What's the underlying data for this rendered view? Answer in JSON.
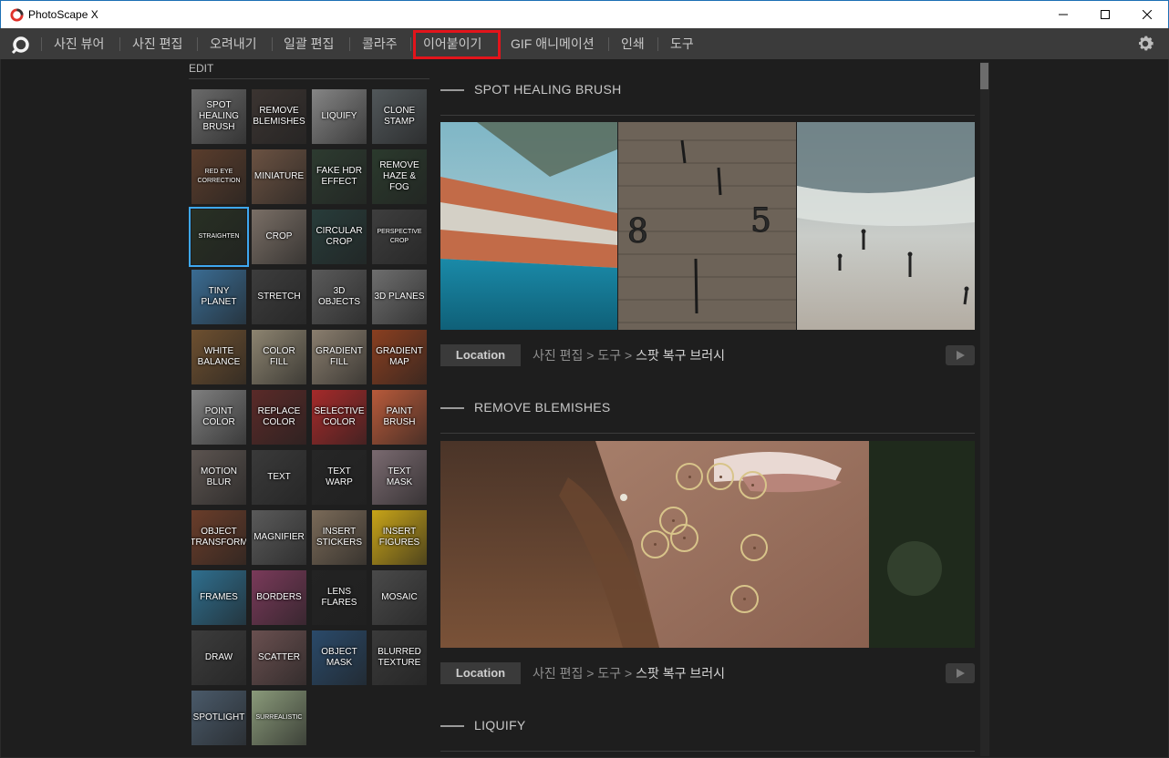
{
  "window": {
    "title": "PhotoScape X"
  },
  "menu": {
    "items": [
      "사진 뷰어",
      "사진 편집",
      "오려내기",
      "일괄 편집",
      "콜라주",
      "이어붙이기",
      "GIF 애니메이션",
      "인쇄",
      "도구"
    ],
    "highlighted": "이어붙이기"
  },
  "sidebar": {
    "label": "EDIT",
    "selected": "STRAIGHTEN",
    "tiles": [
      {
        "label": "SPOT HEALING BRUSH",
        "bg": "#6a6a6a"
      },
      {
        "label": "REMOVE BLEMISHES",
        "bg": "#3b3431"
      },
      {
        "label": "LIQUIFY",
        "bg": "#858585"
      },
      {
        "label": "CLONE STAMP",
        "bg": "#51575a"
      },
      {
        "label": "RED EYE CORRECTION",
        "bg": "#5a3d2c"
      },
      {
        "label": "MINIATURE",
        "bg": "#6b5242"
      },
      {
        "label": "FAKE HDR EFFECT",
        "bg": "#2d3b30"
      },
      {
        "label": "REMOVE HAZE & FOG",
        "bg": "#2b3a2d"
      },
      {
        "label": "STRAIGHTEN",
        "bg": "#283024"
      },
      {
        "label": "CROP",
        "bg": "#7a6f66"
      },
      {
        "label": "CIRCULAR CROP",
        "bg": "#283c3a"
      },
      {
        "label": "PERSPECTIVE CROP",
        "bg": "#3e3e3e"
      },
      {
        "label": "TINY PLANET",
        "bg": "#3a6c93"
      },
      {
        "label": "STRETCH",
        "bg": "#3d3d3d"
      },
      {
        "label": "3D OBJECTS",
        "bg": "#5a5a5a"
      },
      {
        "label": "3D PLANES",
        "bg": "#6e6e6e"
      },
      {
        "label": "WHITE BALANCE",
        "bg": "#6e5030"
      },
      {
        "label": "COLOR FILL",
        "bg": "#8d8470"
      },
      {
        "label": "GRADIENT FILL",
        "bg": "#8a7e6e"
      },
      {
        "label": "GRADIENT MAP",
        "bg": "#8a3f20"
      },
      {
        "label": "POINT COLOR",
        "bg": "#7f7f7f"
      },
      {
        "label": "REPLACE COLOR",
        "bg": "#5a2a28"
      },
      {
        "label": "SELECTIVE COLOR",
        "bg": "#a52a2a"
      },
      {
        "label": "PAINT BRUSH",
        "bg": "#b85a3a"
      },
      {
        "label": "MOTION BLUR",
        "bg": "#5c5450"
      },
      {
        "label": "TEXT",
        "bg": "#3a3a3a"
      },
      {
        "label": "TEXT WARP",
        "bg": "#262626"
      },
      {
        "label": "TEXT MASK",
        "bg": "#7a6a70"
      },
      {
        "label": "OBJECT TRANSFORM",
        "bg": "#6a3d2a"
      },
      {
        "label": "MAGNIFIER",
        "bg": "#5a5a5a"
      },
      {
        "label": "INSERT STICKERS",
        "bg": "#7a6a58"
      },
      {
        "label": "INSERT FIGURES",
        "bg": "#c8a418"
      },
      {
        "label": "FRAMES",
        "bg": "#2f6f8f"
      },
      {
        "label": "BORDERS",
        "bg": "#7a3a5a"
      },
      {
        "label": "LENS FLARES",
        "bg": "#232323"
      },
      {
        "label": "MOSAIC",
        "bg": "#4a4a4a"
      },
      {
        "label": "DRAW",
        "bg": "#3c3c3c"
      },
      {
        "label": "SCATTER",
        "bg": "#6a5050"
      },
      {
        "label": "OBJECT MASK",
        "bg": "#2a4a6a"
      },
      {
        "label": "BLURRED TEXTURE",
        "bg": "#3a3a3a"
      },
      {
        "label": "SPOTLIGHT",
        "bg": "#4a5a6a"
      },
      {
        "label": "SURREALISTIC",
        "bg": "#8a9a7a"
      }
    ]
  },
  "sections": [
    {
      "title": "SPOT HEALING BRUSH",
      "location_label": "Location",
      "path_prefix": "사진 편집 > 도구 > ",
      "path_end": "스팟 복구 브러시"
    },
    {
      "title": "REMOVE BLEMISHES",
      "location_label": "Location",
      "path_prefix": "사진 편집 > 도구 > ",
      "path_end": "스팟 복구 브러시"
    },
    {
      "title": "LIQUIFY"
    }
  ],
  "colors": {
    "highlight": "#e3141b",
    "selected_tile": "#3ea8f0",
    "menubar": "#3b3b3b",
    "background": "#1e1e1e"
  }
}
